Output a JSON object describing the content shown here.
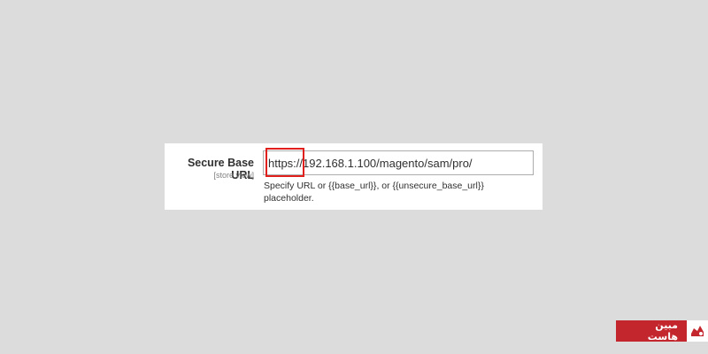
{
  "field": {
    "label": "Secure Base URL",
    "scope": "[store view]",
    "value": "https://192.168.1.100/magento/sam/pro/",
    "note_line1": "Specify URL or {{base_url}}, or {{unsecure_base_url}}",
    "note_line2": "placeholder."
  },
  "highlight": {
    "color": "#e0201c",
    "target": "https://"
  },
  "brand": {
    "name": "مبین هاست",
    "color": "#c4262e",
    "logo_icon": "hosting-logo-icon"
  }
}
